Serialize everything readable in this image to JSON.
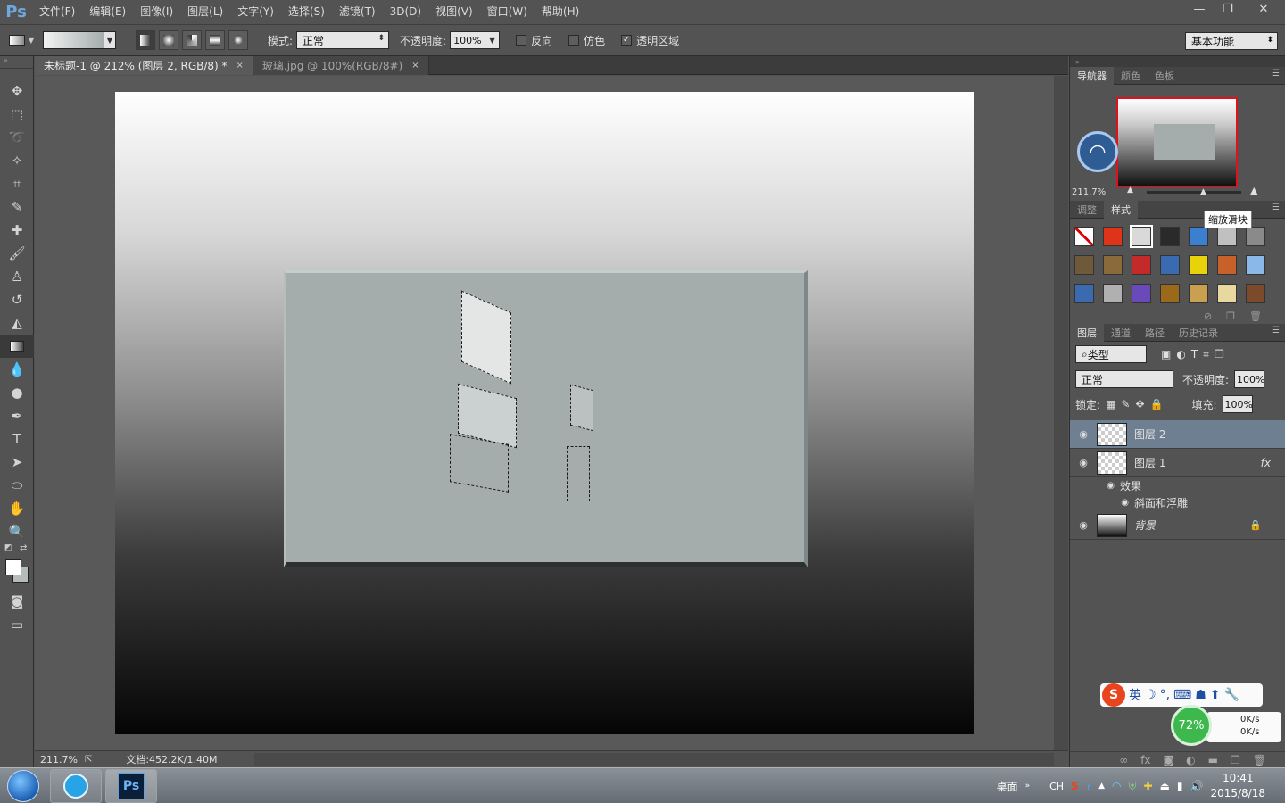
{
  "app": {
    "logo": "Ps"
  },
  "menu": [
    "文件(F)",
    "编辑(E)",
    "图像(I)",
    "图层(L)",
    "文字(Y)",
    "选择(S)",
    "滤镜(T)",
    "3D(D)",
    "视图(V)",
    "窗口(W)",
    "帮助(H)"
  ],
  "window_controls": {
    "minimize": "—",
    "restore": "❐",
    "close": "✕"
  },
  "options": {
    "mode_label": "模式:",
    "mode_value": "正常",
    "opacity_label": "不透明度:",
    "opacity_value": "100%",
    "reverse_label": "反向",
    "dither_label": "仿色",
    "transparency_label": "透明区域",
    "transparency_checked": "✓",
    "workspace": "基本功能"
  },
  "tabs": [
    {
      "label": "未标题-1 @ 212% (图层 2, RGB/8) *",
      "close": "×"
    },
    {
      "label": "玻璃.jpg @ 100%(RGB/8#)",
      "close": "×"
    }
  ],
  "status": {
    "zoom": "211.7%",
    "doc": "文档:452.2K/1.40M"
  },
  "navigator": {
    "tabs": [
      "导航器",
      "颜色",
      "色板"
    ],
    "zoom": "211.7%",
    "zoom_slider_fraction": 0.6
  },
  "styles_panel": {
    "tabs": [
      "调整",
      "样式"
    ],
    "tooltip": "缩放滑块",
    "swatch_colors": [
      "#ffffff",
      "#e0341a",
      "#d9d9d9",
      "#2a2a2a",
      "#3b7fd0",
      "#c0c0c0",
      "#8a8a8a",
      "#6e5a3a",
      "#8a6a3a",
      "#c42a2a",
      "#3a6ab0",
      "#e8d20a",
      "#c8602a",
      "#8ab8e8",
      "#3a6ab0",
      "#b0b0b0",
      "#6a4ab8",
      "#9a6a1a",
      "#c8a050",
      "#e8d8a0",
      "#7a4a2a"
    ]
  },
  "layers_panel": {
    "tabs": [
      "图层",
      "通道",
      "路径",
      "历史记录"
    ],
    "filter": "类型",
    "blend": "正常",
    "opacity_label": "不透明度:",
    "opacity": "100%",
    "lock_label": "锁定:",
    "fill_label": "填充:",
    "fill": "100%",
    "layers": [
      {
        "name": "图层 2"
      },
      {
        "name": "图层 1",
        "fx": "fx"
      },
      {
        "name": "背景"
      }
    ],
    "effects_label": "效果",
    "bevel_label": "斜面和浮雕"
  },
  "ime": {
    "s": "S",
    "lang": "英"
  },
  "net": {
    "percent": "72%",
    "up": "0K/s",
    "down": "0K/s"
  },
  "taskbar": {
    "desktop": "桌面",
    "lang": "CH",
    "time": "10:41",
    "date": "2015/8/18",
    "ps_label": "Ps"
  }
}
